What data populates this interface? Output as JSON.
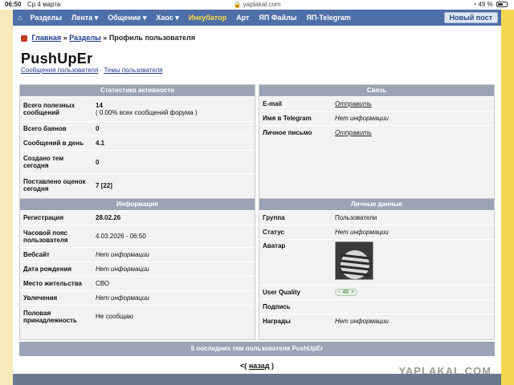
{
  "status": {
    "time": "06:50",
    "date": "Ср 4 марта",
    "url": "yaplakal.com",
    "battery": "49 %"
  },
  "nav": {
    "items": [
      "Разделы",
      "Лента ▾",
      "Общение ▾",
      "Хаос ▾",
      "Инкубатор",
      "Арт",
      "ЯП Файлы",
      "ЯП-Telegram"
    ],
    "new_post": "Новый пост"
  },
  "breadcrumb": {
    "home": "Главная",
    "sep": "»",
    "sections": "Разделы",
    "current": "Профиль пользователя"
  },
  "user": {
    "name": "PushUpEr",
    "link_posts": "Сообщения пользователя",
    "link_sep": "·",
    "link_topics": "Темы пользователя"
  },
  "stats": {
    "title": "Статистика активности",
    "rows": [
      {
        "label": "Всего полезных сообщений",
        "value": "14",
        "sub": "( 0.00% всех сообщений форума )"
      },
      {
        "label": "Всего баянов",
        "value": "0"
      },
      {
        "label": "Сообщений в день",
        "value": "4.1"
      },
      {
        "label": "Создано тем сегодня",
        "value": "0"
      },
      {
        "label": "Поставлено оценок сегодня",
        "value": "7 [22]"
      }
    ]
  },
  "contact": {
    "title": "Связь",
    "rows": [
      {
        "label": "E-mail",
        "value": "Отправить"
      },
      {
        "label": "Имя в Telegram",
        "value": "Нет информации"
      },
      {
        "label": "Личное письмо",
        "value": "Отправить"
      }
    ]
  },
  "info": {
    "title": "Информация",
    "rows": [
      {
        "label": "Регистрация",
        "value": "28.02.26"
      },
      {
        "label": "Часовой пояс пользователя",
        "value": "4.03.2026 - 06:50"
      },
      {
        "label": "Вебсайт",
        "value": "Нет информации"
      },
      {
        "label": "Дата рождения",
        "value": "Нет информации"
      },
      {
        "label": "Место жительства",
        "value": "СВО"
      },
      {
        "label": "Увлечения",
        "value": "Нет информации"
      },
      {
        "label": "Половая принадлежность",
        "value": "Не сообщаю"
      }
    ]
  },
  "personal": {
    "title": "Личные данные",
    "group_label": "Группа",
    "group_value": "Пользователи",
    "status_label": "Статус",
    "status_value": "Нет информации",
    "avatar_label": "Аватар",
    "uq_label": "User Quality",
    "uq_minus": "-",
    "uq_value": "46",
    "uq_plus": "+",
    "sign_label": "Подпись",
    "awards_label": "Награды",
    "awards_value": "Нет информации"
  },
  "last_topics": "5 последних тем пользователя PushUpEr",
  "back": {
    "open": "<(",
    "label": "назад",
    "close": ")"
  },
  "watermark": "YAPLAKAL.COM",
  "colors": {
    "nav_bg": "#4e6fa8",
    "panel_head": "#9aa4b4",
    "accent_yellow": "#f3d74f"
  }
}
